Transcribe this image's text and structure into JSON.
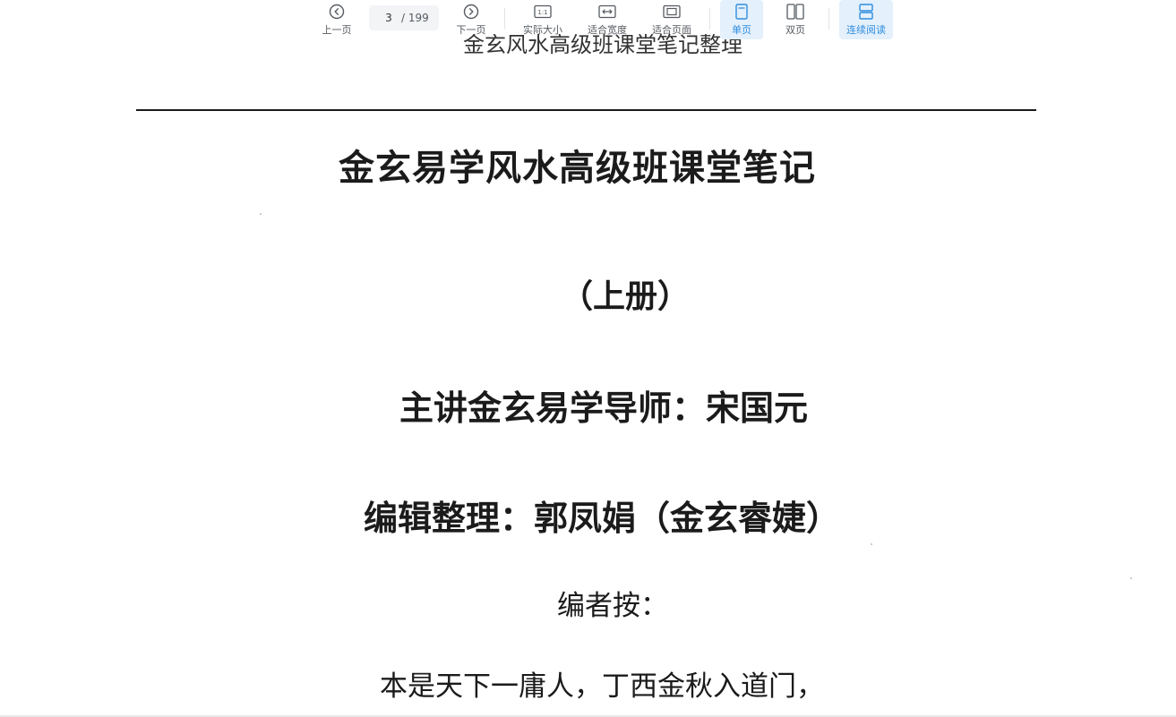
{
  "toolbar": {
    "prev_page": "上一页",
    "current_page": "3",
    "total_pages": "/ 199",
    "next_page": "下一页",
    "actual_size": "实际大小",
    "actual_size_glyph": "1:1",
    "fit_width": "适合宽度",
    "fit_page": "适合页面",
    "single_page": "单页",
    "double_page": "双页",
    "continuous": "连续阅读",
    "active_color": "#2f8ee0",
    "active_bg": "#e4f0fb"
  },
  "document": {
    "prev_page_header": "金玄风水高级班课堂笔记整理",
    "title": "金玄易学风水高级班课堂笔记",
    "volume": "（上册）",
    "lecturer": "主讲金玄易学导师：宋国元",
    "editor": "编辑整理：郭凤娟（金玄睿婕）",
    "note_heading": "编者按：",
    "poem_line_1": "本是天下一庸人，丁西金秋入道门，"
  }
}
